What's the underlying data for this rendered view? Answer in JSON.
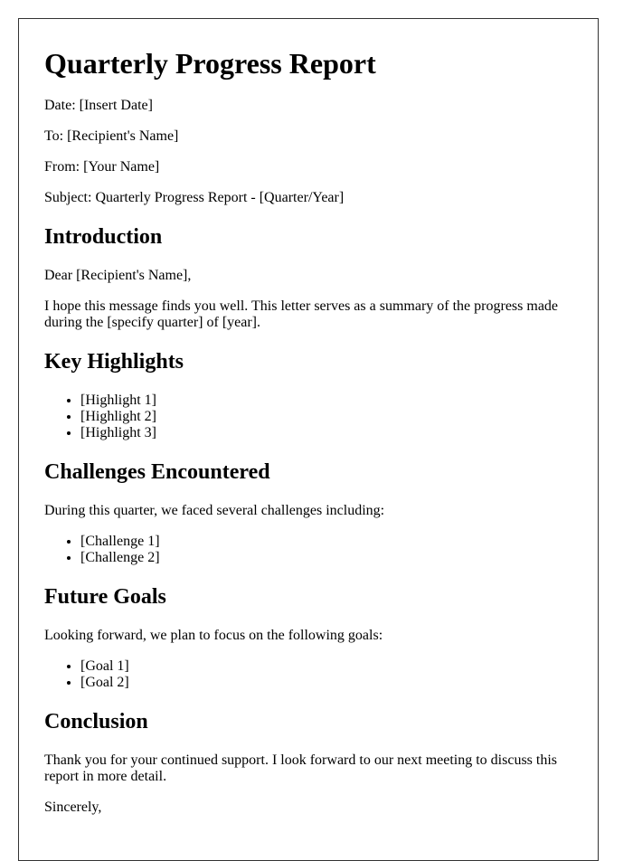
{
  "document": {
    "title": "Quarterly Progress Report",
    "meta": {
      "date": "Date: [Insert Date]",
      "to": "To: [Recipient's Name]",
      "from": "From: [Your Name]",
      "subject": "Subject: Quarterly Progress Report - [Quarter/Year]"
    },
    "introduction": {
      "heading": "Introduction",
      "salutation": "Dear [Recipient's Name],",
      "body": "I hope this message finds you well. This letter serves as a summary of the progress made during the [specify quarter] of [year]."
    },
    "highlights": {
      "heading": "Key Highlights",
      "items": [
        "[Highlight 1]",
        "[Highlight 2]",
        "[Highlight 3]"
      ]
    },
    "challenges": {
      "heading": "Challenges Encountered",
      "intro": "During this quarter, we faced several challenges including:",
      "items": [
        "[Challenge 1]",
        "[Challenge 2]"
      ]
    },
    "goals": {
      "heading": "Future Goals",
      "intro": "Looking forward, we plan to focus on the following goals:",
      "items": [
        "[Goal 1]",
        "[Goal 2]"
      ]
    },
    "conclusion": {
      "heading": "Conclusion",
      "body": "Thank you for your continued support. I look forward to our next meeting to discuss this report in more detail.",
      "closing": "Sincerely,"
    }
  }
}
